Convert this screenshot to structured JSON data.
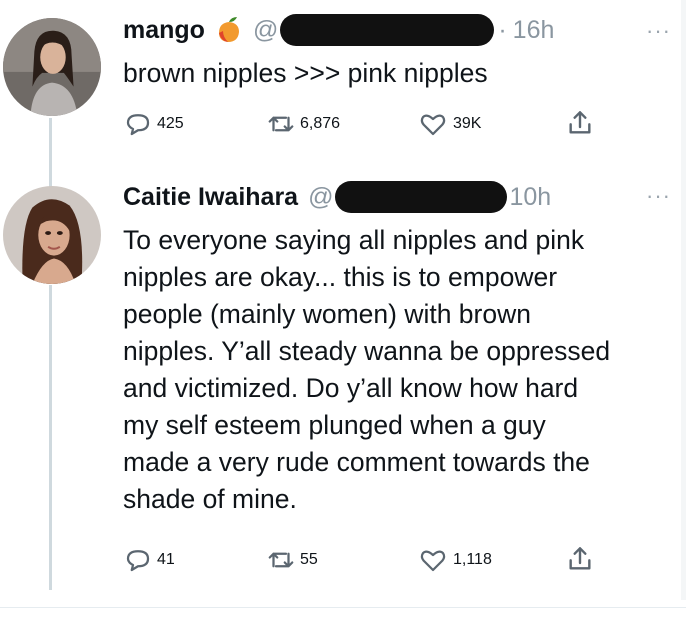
{
  "tweets": [
    {
      "name": "mango",
      "handle": "@",
      "time": "16h",
      "text": "brown nipples >>> pink nipples",
      "reply_count": "425",
      "retweet_count": "6,876",
      "like_count": "39K",
      "more_label": "···",
      "emoji": "mango-emoji"
    },
    {
      "name": "Caitie Iwaihara",
      "handle": "@",
      "time": "10h",
      "text_lines": [
        "To everyone saying all nipples and pink",
        "nipples are okay... this is to empower",
        "people (mainly women) with brown",
        "nipples. Y’all steady wanna be oppressed",
        "and victimized. Do y’all know how hard",
        "my self esteem plunged when a guy",
        "made a very rude comment towards the",
        "shade of mine."
      ],
      "reply_count": "41",
      "retweet_count": "55",
      "like_count": "1,118",
      "more_label": "···"
    }
  ],
  "colors": {
    "text": "#0f1419",
    "muted": "#8a96a0",
    "action": "#5b6670",
    "thread_line": "#cfd9de",
    "redaction": "#111111"
  },
  "icons": [
    "reply-icon",
    "retweet-icon",
    "like-icon",
    "share-icon",
    "more-icon",
    "mango-emoji-icon"
  ]
}
